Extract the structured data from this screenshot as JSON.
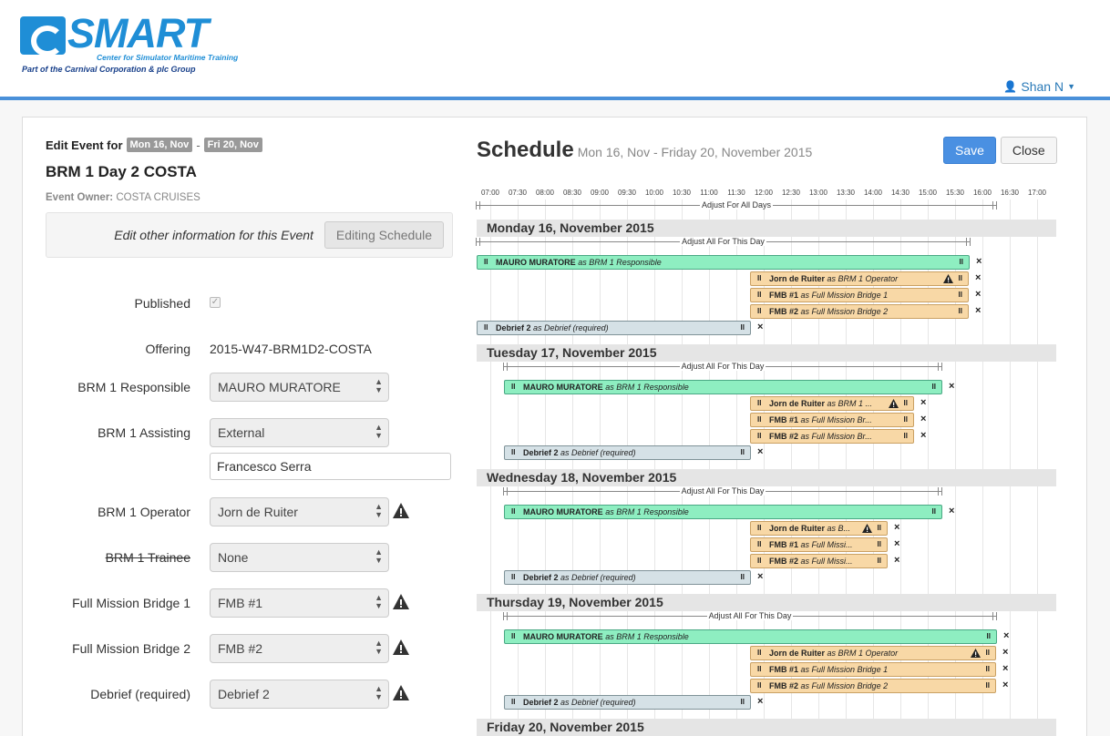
{
  "logo": {
    "word": "SMART",
    "line1": "Center for Simulator Maritime Training",
    "line2": "Part of the Carnival Corporation & plc Group"
  },
  "user": {
    "name": "Shan N"
  },
  "event": {
    "edit_for": "Edit Event for",
    "date_from": "Mon 16, Nov",
    "date_sep": "-",
    "date_to": "Fri 20, Nov",
    "title": "BRM 1 Day 2 COSTA",
    "owner_label": "Event Owner:",
    "owner_value": "COSTA CRUISES",
    "info_label": "Edit other information for this Event",
    "info_button": "Editing Schedule"
  },
  "form": {
    "published_label": "Published",
    "published_check": "✓",
    "offering_label": "Offering",
    "offering_value": "2015-W47-BRM1D2-COSTA",
    "fields": [
      {
        "label": "BRM 1 Responsible",
        "value": "MAURO MURATORE"
      },
      {
        "label": "BRM 1 Assisting",
        "value": "External",
        "extra": "Francesco Serra"
      },
      {
        "label": "BRM 1 Operator",
        "value": "Jorn de Ruiter"
      },
      {
        "label": "BRM 1 Trainee",
        "value": "None"
      },
      {
        "label": "Full Mission Bridge 1",
        "value": "FMB #1"
      },
      {
        "label": "Full Mission Bridge 2",
        "value": "FMB #2"
      },
      {
        "label": "Debrief (required)",
        "value": "Debrief 2"
      }
    ]
  },
  "schedule": {
    "title": "Schedule",
    "range": "Mon 16, Nov - Friday 20, November 2015",
    "save": "Save",
    "close": "Close",
    "hours": [
      "07:00",
      "07:30",
      "08:00",
      "08:30",
      "09:00",
      "09:30",
      "10:00",
      "10:30",
      "11:00",
      "11:30",
      "12:00",
      "12:30",
      "13:00",
      "13:30",
      "14:00",
      "14:30",
      "15:00",
      "15:30",
      "16:00",
      "16:30",
      "17:00"
    ],
    "adjust_all_days": "Adjust For All Days",
    "adjust_day": "Adjust All For This Day",
    "days": [
      {
        "label": "Monday 16, November 2015",
        "bars": [
          {
            "name": "MAURO MURATORE",
            "as": "as",
            "role": "BRM 1 Responsible"
          },
          {
            "name": "Jorn de Ruiter",
            "as": "as",
            "role": "BRM 1 Operator"
          },
          {
            "name": "FMB #1",
            "as": "as",
            "role": "Full Mission Bridge 1"
          },
          {
            "name": "FMB #2",
            "as": "as",
            "role": "Full Mission Bridge 2"
          },
          {
            "name": "Debrief 2",
            "as": "as",
            "role": "Debrief (required)"
          }
        ]
      },
      {
        "label": "Tuesday 17, November 2015",
        "bars": [
          {
            "name": "MAURO MURATORE",
            "as": "as",
            "role": "BRM 1 Responsible"
          },
          {
            "name": "Jorn de Ruiter",
            "as": "as",
            "role": "BRM 1 ..."
          },
          {
            "name": "FMB #1",
            "as": "as",
            "role": "Full Mission Br..."
          },
          {
            "name": "FMB #2",
            "as": "as",
            "role": "Full Mission Br..."
          },
          {
            "name": "Debrief 2",
            "as": "as",
            "role": "Debrief (required)"
          }
        ]
      },
      {
        "label": "Wednesday 18, November 2015",
        "bars": [
          {
            "name": "MAURO MURATORE",
            "as": "as",
            "role": "BRM 1 Responsible"
          },
          {
            "name": "Jorn de Ruiter",
            "as": "as",
            "role": "B..."
          },
          {
            "name": "FMB #1",
            "as": "as",
            "role": "Full Missi..."
          },
          {
            "name": "FMB #2",
            "as": "as",
            "role": "Full Missi..."
          },
          {
            "name": "Debrief 2",
            "as": "as",
            "role": "Debrief (required)"
          }
        ]
      },
      {
        "label": "Thursday 19, November 2015",
        "bars": [
          {
            "name": "MAURO MURATORE",
            "as": "as",
            "role": "BRM 1 Responsible"
          },
          {
            "name": "Jorn de Ruiter",
            "as": "as",
            "role": "BRM 1 Operator"
          },
          {
            "name": "FMB #1",
            "as": "as",
            "role": "Full Mission Bridge 1"
          },
          {
            "name": "FMB #2",
            "as": "as",
            "role": "Full Mission Bridge 2"
          },
          {
            "name": "Debrief 2",
            "as": "as",
            "role": "Debrief (required)"
          }
        ]
      },
      {
        "label": "Friday 20, November 2015",
        "bars": []
      }
    ]
  },
  "colors": {
    "responsible": "#8eeec1",
    "resource": "#f8d8a6",
    "debrief": "#d5e1e6",
    "accent": "#4a90e2"
  }
}
